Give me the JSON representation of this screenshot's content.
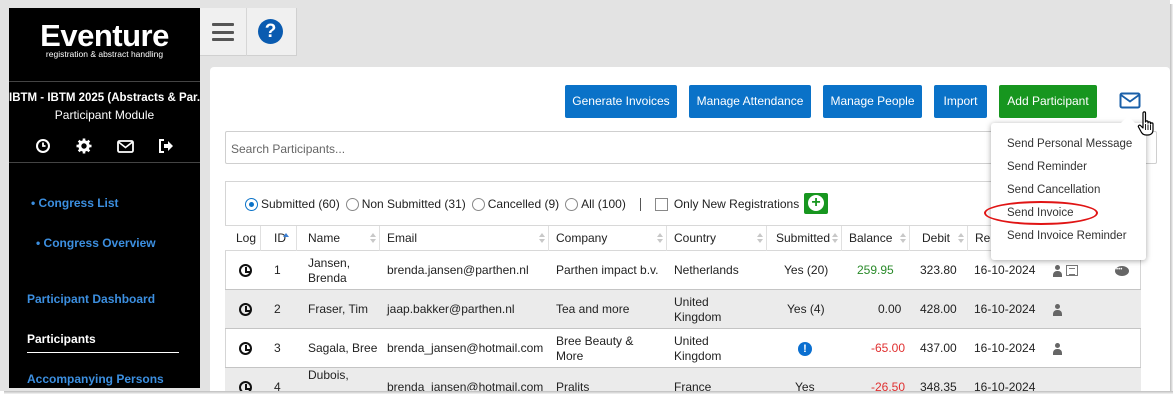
{
  "sidebar": {
    "logo": "Eventure",
    "tagline": "registration & abstract handling",
    "congress": "IBTM - IBTM 2025 (Abstracts & Par...",
    "module": "Participant Module",
    "icons": [
      "clock-icon",
      "gear-icon",
      "envelope-icon",
      "sign-out-icon"
    ],
    "links": {
      "congress_list": "• Congress List",
      "congress_overview": "• Congress Overview",
      "participant_dashboard": "Participant Dashboard",
      "participants": "Participants",
      "accompanying_persons": "Accompanying Persons"
    }
  },
  "toolbar": {
    "menu_icon": "hamburger-icon",
    "help_label": "?"
  },
  "actions": {
    "generate_invoices": "Generate Invoices",
    "manage_attendance": "Manage Attendance",
    "manage_people": "Manage People",
    "import": "Import",
    "add_participant": "Add Participant",
    "mail_icon": "envelope-icon"
  },
  "search": {
    "placeholder": "Search Participants..."
  },
  "filters": {
    "submitted": "Submitted (60)",
    "non_submitted": "Non Submitted (31)",
    "cancelled": "Cancelled (9)",
    "all": "All (100)",
    "only_new": "Only New Registrations",
    "selected": "Submitted (60)"
  },
  "table": {
    "columns": {
      "log": "Log",
      "id": "ID",
      "name": "Name",
      "email": "Email",
      "company": "Company",
      "country": "Country",
      "submitted": "Submitted",
      "balance": "Balance",
      "debit": "Debit",
      "registered": "Re"
    },
    "rows": [
      {
        "id": "1",
        "name": "Jansen, Brenda",
        "email": "brenda.jansen@parthen.nl",
        "company": "Parthen impact b.v.",
        "country": "Netherlands",
        "submitted": "Yes (20)",
        "balance": "259.95",
        "debit": "323.80",
        "date": "16-10-2024"
      },
      {
        "id": "2",
        "name": "Fraser, Tim",
        "email": "jaap.bakker@parthen.nl",
        "company": "Tea and more",
        "country": "United Kingdom",
        "submitted": "Yes (4)",
        "balance": "0.00",
        "debit": "428.00",
        "date": "16-10-2024"
      },
      {
        "id": "3",
        "name": "Sagala, Bree",
        "email": "brenda_jansen@hotmail.com",
        "company": "Bree Beauty & More",
        "country": "United Kingdom",
        "submitted": "!",
        "balance": "-65.00",
        "debit": "437.00",
        "date": "16-10-2024"
      },
      {
        "id": "4",
        "name": "Dubois,",
        "email": "brenda_jansen@hotmail.com",
        "company": "Pralits",
        "country": "France",
        "submitted": "Yes",
        "balance": "-26.50",
        "debit": "348.35",
        "date": "16-10-2024"
      }
    ]
  },
  "mail_menu": {
    "items": [
      "Send Personal Message",
      "Send Reminder",
      "Send Cancellation",
      "Send Invoice",
      "Send Invoice Reminder"
    ],
    "highlighted": "Send Invoice"
  },
  "colors": {
    "primary": "#0a72c8",
    "success": "#17961f",
    "sidebar": "#000000",
    "link": "#3c8fe0",
    "highlight": "#e01414"
  }
}
